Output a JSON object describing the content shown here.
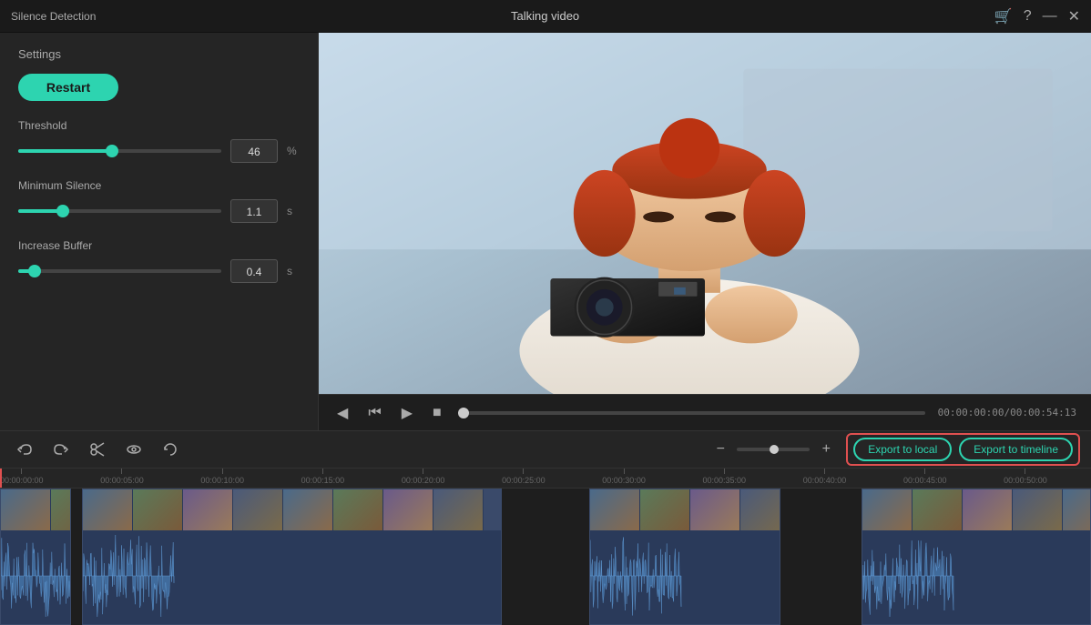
{
  "titlebar": {
    "left_title": "Silence Detection",
    "center_title": "Talking video",
    "cart_icon": "🛒",
    "help_icon": "?",
    "minimize_icon": "—",
    "close_icon": "✕"
  },
  "left_panel": {
    "settings_label": "Settings",
    "restart_button": "Restart",
    "threshold": {
      "label": "Threshold",
      "value": "46",
      "unit": "%",
      "fill_percent": 46
    },
    "minimum_silence": {
      "label": "Minimum Silence",
      "value": "1.1",
      "unit": "s",
      "fill_percent": 22
    },
    "increase_buffer": {
      "label": "Increase Buffer",
      "value": "0.4",
      "unit": "s",
      "fill_percent": 8
    }
  },
  "controls": {
    "time_current": "00:00:00:00",
    "time_total": "00:00:54:13"
  },
  "toolbar": {
    "undo_label": "↺",
    "redo_label": "↻",
    "cut_label": "✂",
    "visibility_label": "👁",
    "restore_label": "⟳"
  },
  "exports": {
    "export_local": "Export to local",
    "export_timeline": "Export to timeline"
  },
  "timeline": {
    "marks": [
      {
        "label": "00:00:00:00",
        "left_pct": 0
      },
      {
        "label": "00:00:05:00",
        "left_pct": 9.2
      },
      {
        "label": "00:00:10:00",
        "left_pct": 18.4
      },
      {
        "label": "00:00:15:00",
        "left_pct": 27.6
      },
      {
        "label": "00:00:20:00",
        "left_pct": 36.8
      },
      {
        "label": "00:00:25:00",
        "left_pct": 46.0
      },
      {
        "label": "00:00:30:00",
        "left_pct": 55.2
      },
      {
        "label": "00:00:35:00",
        "left_pct": 64.4
      },
      {
        "label": "00:00:40:00",
        "left_pct": 73.6
      },
      {
        "label": "00:00:45:00",
        "left_pct": 82.8
      },
      {
        "label": "00:00:50:00",
        "left_pct": 92.0
      }
    ],
    "clips": [
      {
        "left_pct": 0,
        "width_pct": 6.5
      },
      {
        "left_pct": 7.5,
        "width_pct": 38.5
      },
      {
        "left_pct": 54,
        "width_pct": 17.5
      },
      {
        "left_pct": 79,
        "width_pct": 21
      }
    ]
  }
}
